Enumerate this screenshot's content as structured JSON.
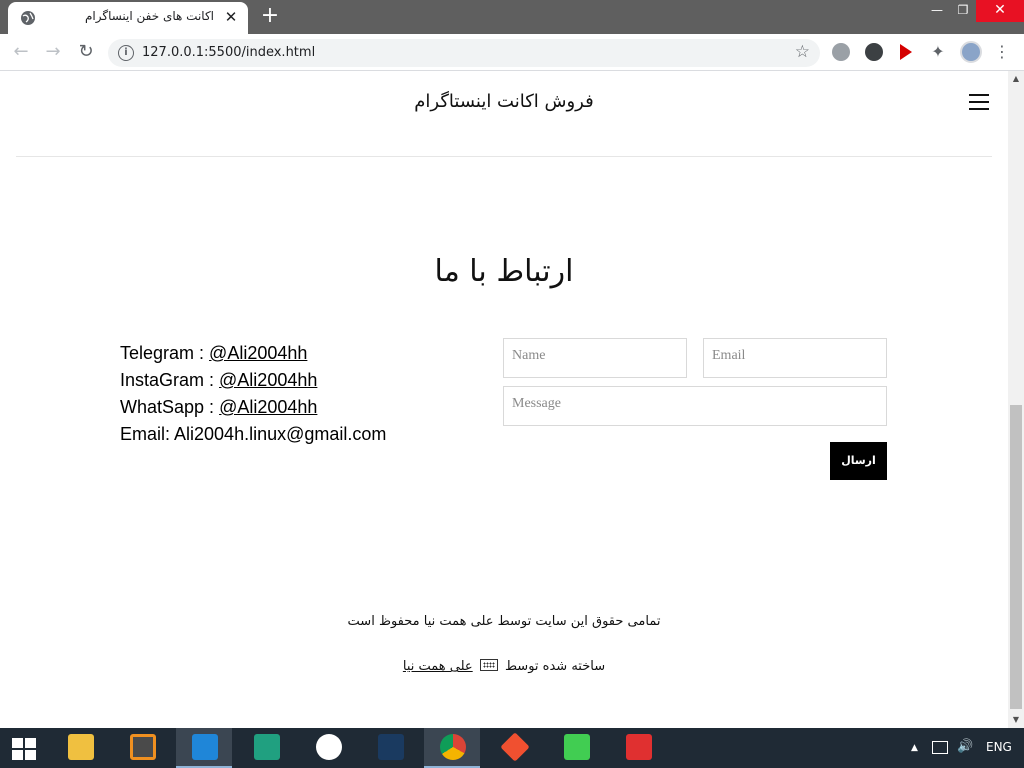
{
  "browser": {
    "tab_title": "اکانت های خفن اینساگرام",
    "tab_close": "✕",
    "new_tab": "+",
    "url": "127.0.0.1:5500/index.html",
    "window_minimize": "—",
    "window_maximize": "❐",
    "window_close": "✕"
  },
  "page": {
    "site_title": "فروش اکانت اینستاگرام",
    "contact_heading": "ارتباط با ما",
    "contact_info": [
      {
        "label": "Telegram : ",
        "link": "@Ali2004hh"
      },
      {
        "label": "InstaGram : ",
        "link": "@Ali2004hh"
      },
      {
        "label": "WhatSapp : ",
        "link": "@Ali2004hh"
      },
      {
        "label": "Email: Ali2004h.linux@gmail.com",
        "link": ""
      }
    ],
    "form": {
      "name_placeholder": "Name",
      "email_placeholder": "Email",
      "message_placeholder": "Message",
      "submit_label": "ارسال"
    },
    "footer": {
      "copyright": "تمامی حقوق این سایت توسط علی همت نیا محفوظ است",
      "credit_prefix": "ساخته شده توسط",
      "credit_name": "علی همت نیا"
    }
  },
  "taskbar": {
    "language": "ENG"
  }
}
